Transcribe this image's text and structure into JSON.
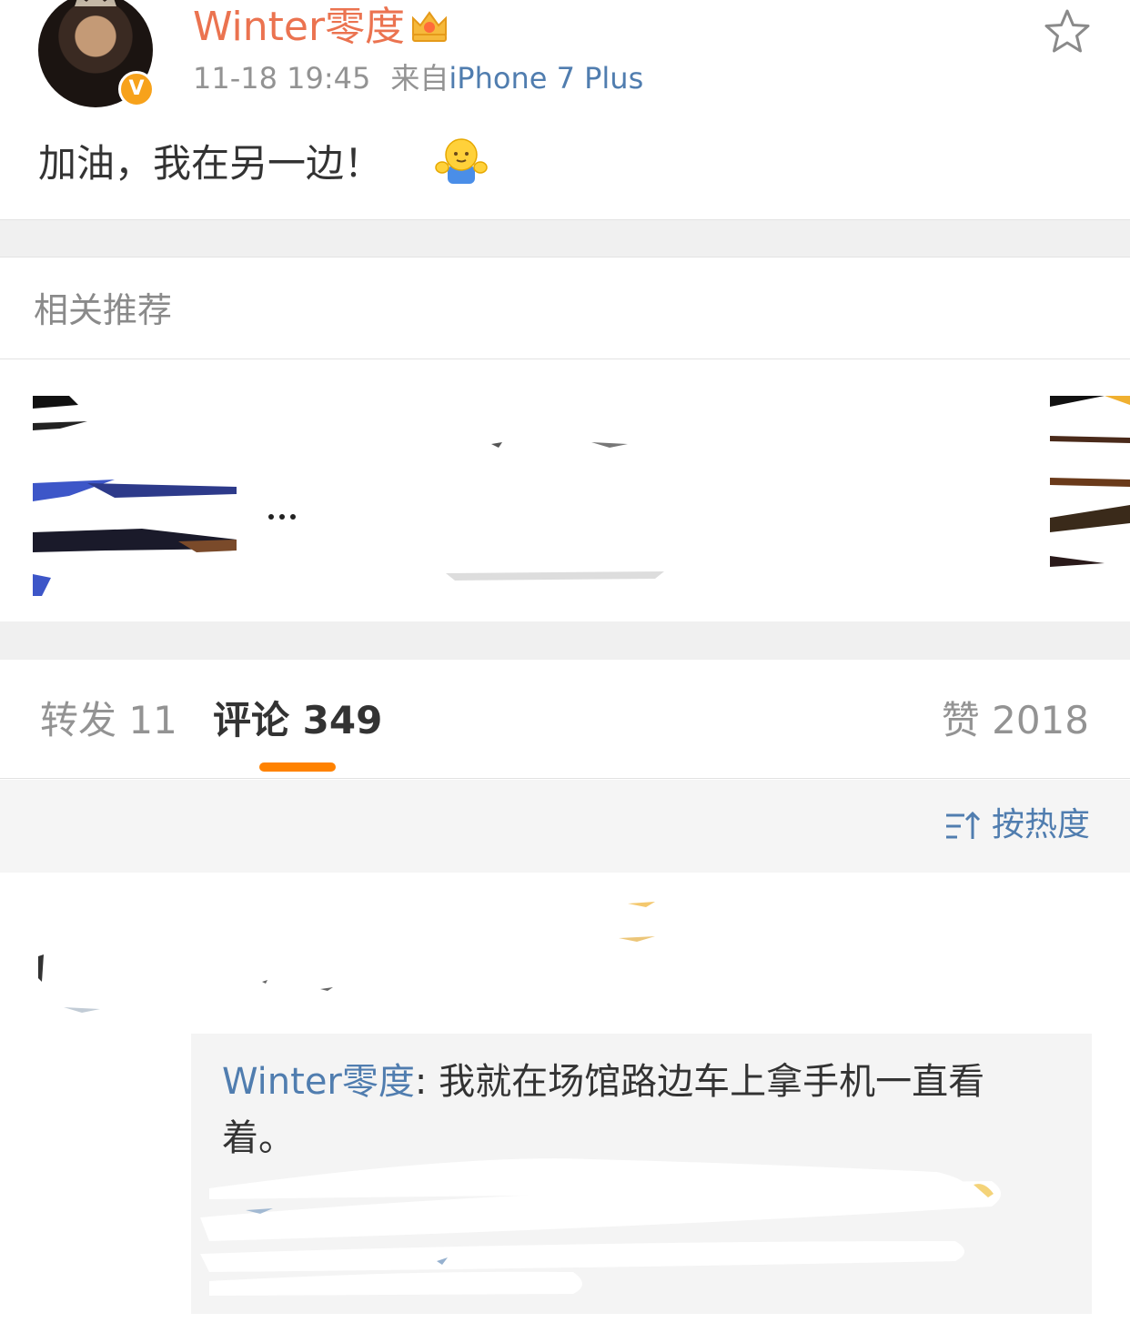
{
  "post": {
    "username": "Winter零度",
    "time": "11-18 19:45",
    "source_label": "来自",
    "source_device": "iPhone 7 Plus",
    "text": "加油，我在另一边！",
    "badges": {
      "verified": "V"
    },
    "icons": [
      "avatar",
      "vip-crown-icon",
      "verified-icon",
      "star-icon",
      "hug-emoji-icon"
    ]
  },
  "recommend": {
    "title": "相关推荐",
    "ellipsis": "..."
  },
  "tabs": [
    {
      "label": "转发",
      "count": "11"
    },
    {
      "label": "评论",
      "count": "349"
    },
    {
      "label": "赞",
      "count": "2018"
    }
  ],
  "tabs_display": {
    "repost": "转发 11",
    "comment": "评论 349",
    "like": "赞 2018"
  },
  "sort": {
    "label": "按热度",
    "icon": "sort-icon"
  },
  "reply": {
    "author": "Winter零度",
    "separator": ": ",
    "text": "我就在场馆路边车上拿手机一直看着。"
  },
  "colors": {
    "username": "#eb7350",
    "link": "#507daf",
    "tab_underline": "#ff8200",
    "muted": "#939393",
    "band": "#f0f0f0"
  }
}
